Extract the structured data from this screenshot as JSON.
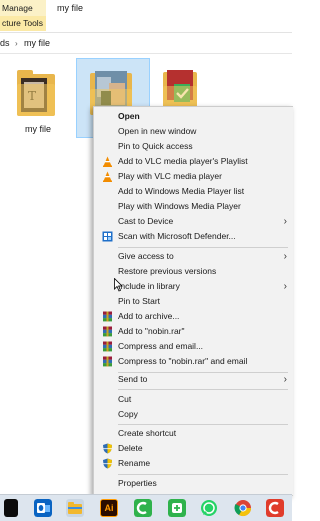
{
  "ribbon": {
    "manage_label": "Manage",
    "tools_label": "cture Tools",
    "window_title": "my file"
  },
  "address": {
    "crumb_parent": "ds",
    "separator": "›",
    "crumb_current": "my file"
  },
  "files": [
    {
      "name": "my file",
      "icon": "folder-icon"
    },
    {
      "name": "",
      "icon": "image-folder-icon"
    },
    {
      "name": "",
      "icon": "folder-icon"
    }
  ],
  "menu": {
    "items": [
      {
        "label": "Open",
        "icon": "",
        "bold": true
      },
      {
        "label": "Open in new window",
        "icon": ""
      },
      {
        "label": "Pin to Quick access",
        "icon": ""
      },
      {
        "label": "Add to VLC media player's Playlist",
        "icon": "vlc-icon"
      },
      {
        "label": "Play with VLC media player",
        "icon": "vlc-icon"
      },
      {
        "label": "Add to Windows Media Player list",
        "icon": ""
      },
      {
        "label": "Play with Windows Media Player",
        "icon": ""
      },
      {
        "label": "Cast to Device",
        "icon": "",
        "submenu": true
      },
      {
        "label": "Scan with Microsoft Defender...",
        "icon": "defender-icon"
      },
      {
        "label": "Give access to",
        "icon": "",
        "submenu": true
      },
      {
        "label": "Restore previous versions",
        "icon": ""
      },
      {
        "label": "Include in library",
        "icon": "",
        "submenu": true
      },
      {
        "label": "Pin to Start",
        "icon": ""
      },
      {
        "label": "Add to archive...",
        "icon": "winrar-icon"
      },
      {
        "label": "Add to \"nobin.rar\"",
        "icon": "winrar-icon"
      },
      {
        "label": "Compress and email...",
        "icon": "winrar-icon"
      },
      {
        "label": "Compress to \"nobin.rar\" and email",
        "icon": "winrar-icon"
      },
      {
        "label": "Send to",
        "icon": "",
        "submenu": true
      },
      {
        "label": "Cut",
        "icon": ""
      },
      {
        "label": "Copy",
        "icon": ""
      },
      {
        "label": "Create shortcut",
        "icon": ""
      },
      {
        "label": "Delete",
        "icon": "shield-icon"
      },
      {
        "label": "Rename",
        "icon": "shield-icon"
      },
      {
        "label": "Properties",
        "icon": ""
      }
    ],
    "submenu_arrow": "›"
  },
  "taskbar": {
    "apps": [
      "outlook-icon",
      "file-explorer-icon",
      "illustrator-icon",
      "camtasia-icon",
      "whatsapp-icon",
      "chrome-icon",
      "camtasia-recorder-icon"
    ],
    "illustrator_label": "Ai"
  },
  "colors": {
    "selection": "#cce4f7",
    "menu_bg": "#f2f2f2",
    "manage_tab": "#fbf1c7",
    "vlc": "#f28c00",
    "winrar": "#9b1c3a"
  }
}
